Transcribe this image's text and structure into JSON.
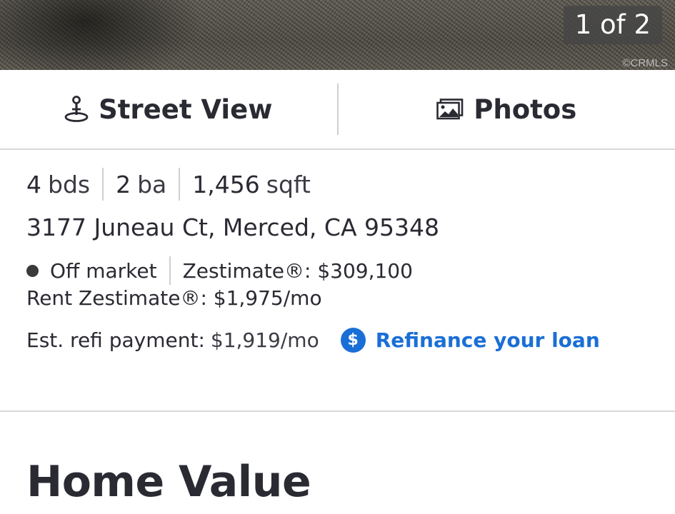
{
  "photo": {
    "counter": "1 of 2",
    "credit": "©CRMLS"
  },
  "view_bar": {
    "street_view_label": "Street View",
    "street_view_icon": "street-view-pin-icon",
    "photos_label": "Photos",
    "photos_icon": "photos-icon"
  },
  "facts": {
    "beds_value": "4",
    "beds_unit": "bds",
    "baths_value": "2",
    "baths_unit": "ba",
    "sqft_value": "1,456",
    "sqft_unit": "sqft"
  },
  "address": "3177 Juneau Ct, Merced, CA 95348",
  "status": {
    "label": "Off market",
    "dot_color": "#3a3a3a",
    "zestimate": "Zestimate®: $309,100"
  },
  "rent_zestimate": "Rent Zestimate®: $1,975/mo",
  "refi": {
    "label": "Est. refi payment:",
    "value": "$1,919/mo",
    "link_icon_glyph": "$",
    "link_label": "Refinance your loan",
    "link_color": "#1a6fd6"
  },
  "section": {
    "title": "Home Value"
  }
}
